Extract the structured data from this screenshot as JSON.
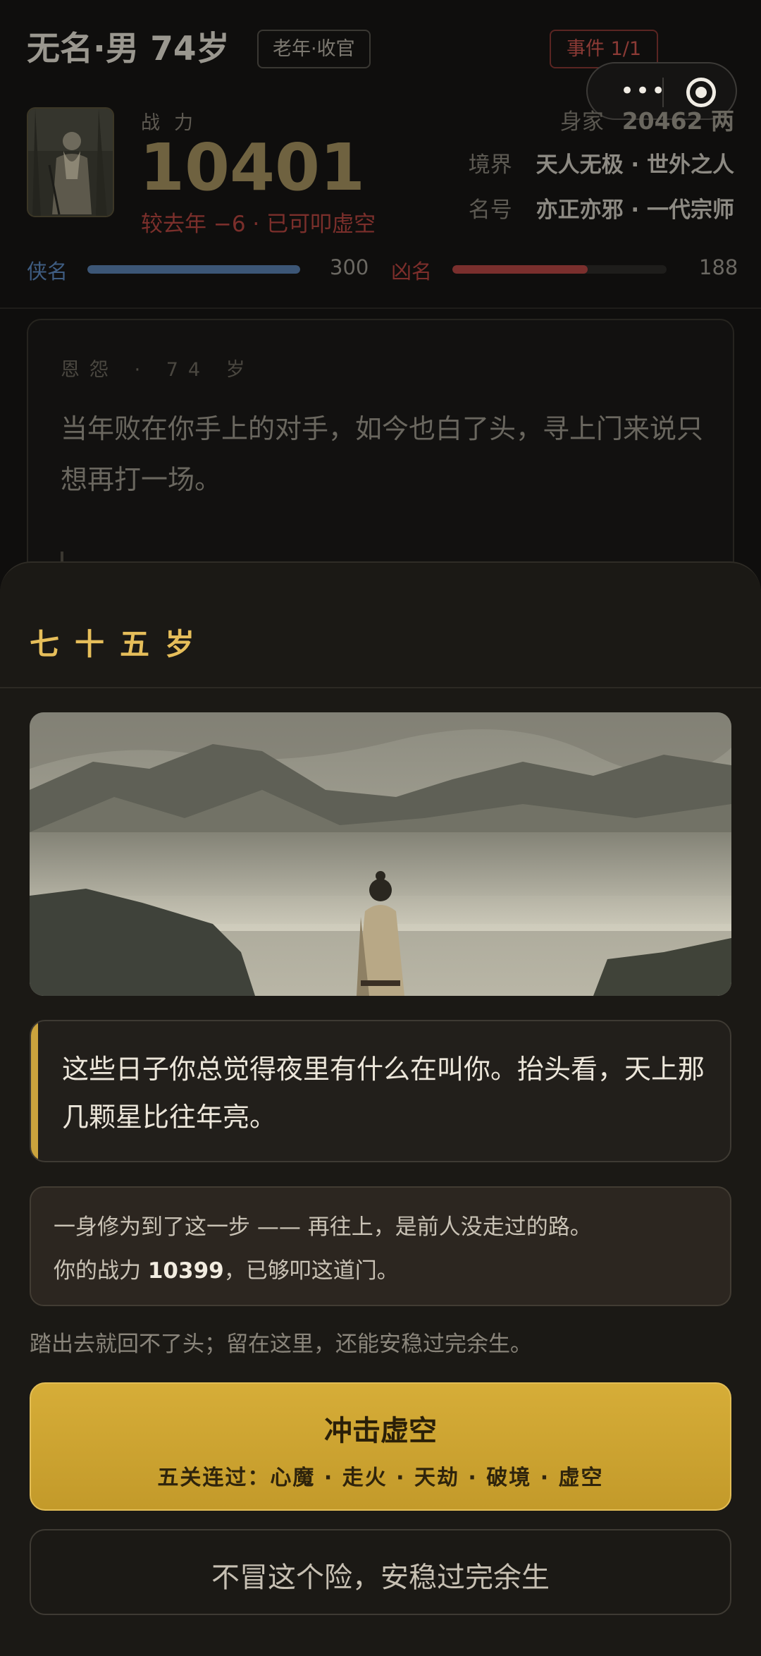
{
  "header": {
    "char_name": "无名·男 74岁",
    "stage_badge": "老年·收官",
    "event_badge": "事件 1/1",
    "capsule_more": "•••",
    "power_label": "战力",
    "power_value": "10401",
    "power_delta": "较去年 −6 · 已可叩虚空",
    "wealth_label": "身家",
    "wealth_value": "20462 两",
    "realm_label": "境界",
    "realm_value": "天人无极 · 世外之人",
    "title_label": "名号",
    "title_value": "亦正亦邪 · 一代宗师",
    "good_rep_label": "侠名",
    "good_rep_value": "300",
    "good_rep_fill": 1.0,
    "bad_rep_label": "凶名",
    "bad_rep_value": "188",
    "bad_rep_fill": 0.63
  },
  "event": {
    "meta": "恩怨 · 74 岁",
    "text": "当年败在你手上的对手，如今也白了头，寻上门来说只想再打一场。"
  },
  "sheet": {
    "title": "七十五岁",
    "story": "这些日子你总觉得夜里有什么在叫你。抬头看，天上那几颗星比往年亮。",
    "info_line1": "一身修为到了这一步 —— 再往上，是前人没走过的路。",
    "info_line2_prefix": "你的战力 ",
    "info_line2_value": "10399",
    "info_line2_suffix": "，已够叩这道门。",
    "warning": "踏出去就回不了头；留在这里，还能安稳过完余生。",
    "primary_label": "冲击虚空",
    "primary_sub": "五关连过：心魔 · 走火 · 天劫 · 破境 · 虚空",
    "secondary_label": "不冒这个险，安稳过完余生"
  },
  "colors": {
    "accent_gold": "#caa33d",
    "title_gold": "#e6be5a",
    "button_gold": "#d6ad38",
    "good_blue": "#3c5676",
    "bad_red": "#7a2f2d"
  }
}
